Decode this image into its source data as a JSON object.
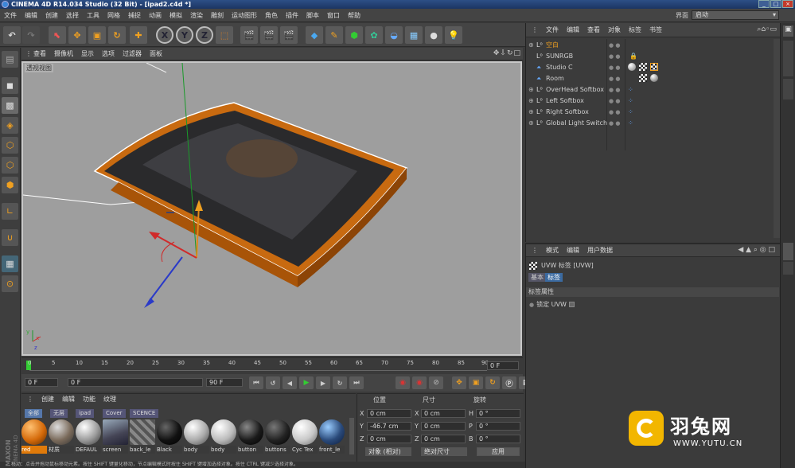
{
  "window": {
    "title": "CINEMA 4D R14.034 Studio (32 Bit) - [ipad2.c4d *]"
  },
  "menu": [
    "文件",
    "编辑",
    "创建",
    "选择",
    "工具",
    "网格",
    "捕捉",
    "动画",
    "模拟",
    "渲染",
    "雕刻",
    "运动图形",
    "角色",
    "插件",
    "脚本",
    "窗口",
    "帮助"
  ],
  "layout": {
    "label": "界面",
    "value": "启动"
  },
  "toolbar": {
    "x": "X",
    "y": "Y",
    "z": "Z"
  },
  "viewport": {
    "menu": [
      "查看",
      "摄像机",
      "显示",
      "选项",
      "过滤器",
      "面板"
    ],
    "label": "透视视图"
  },
  "timeline": {
    "ticks": [
      "0",
      "5",
      "10",
      "15",
      "20",
      "25",
      "30",
      "35",
      "40",
      "45",
      "50",
      "55",
      "60",
      "65",
      "70",
      "75",
      "80",
      "85",
      "90"
    ],
    "end_field": "0 F"
  },
  "transport": {
    "start": "0 F",
    "cur": "0 F",
    "mid": "90 F",
    "end": "90 F"
  },
  "materials": {
    "menu": [
      "创建",
      "编辑",
      "功能",
      "纹理"
    ],
    "tabs": [
      "全部",
      "无层",
      "ipad",
      "Cover",
      "SCENCE"
    ],
    "items": [
      {
        "name": "red",
        "color": "#d46a0a"
      },
      {
        "name": "材质",
        "color": "#7a6a5a"
      },
      {
        "name": "DEFAUL",
        "color": "#9a9a9a"
      },
      {
        "name": "screen",
        "color": "#6a7080"
      },
      {
        "name": "back_le",
        "color": "#777"
      },
      {
        "name": "Black",
        "color": "#111"
      },
      {
        "name": "body",
        "color": "#aaa"
      },
      {
        "name": "body",
        "color": "#bbb"
      },
      {
        "name": "button",
        "color": "#1a1a1a"
      },
      {
        "name": "buttons",
        "color": "#222"
      },
      {
        "name": "Cyc Tex",
        "color": "#c8c8c8"
      },
      {
        "name": "front_le",
        "color": "#2a4a7a"
      }
    ]
  },
  "coords": {
    "headers": [
      "位置",
      "尺寸",
      "旋转"
    ],
    "rows": [
      {
        "a": "X",
        "av": "0 cm",
        "b": "X",
        "bv": "0 cm",
        "c": "H",
        "cv": "0 °"
      },
      {
        "a": "Y",
        "av": "-46.7 cm",
        "b": "Y",
        "bv": "0 cm",
        "c": "P",
        "cv": "0 °"
      },
      {
        "a": "Z",
        "av": "0 cm",
        "b": "Z",
        "bv": "0 cm",
        "c": "B",
        "cv": "0 °"
      }
    ],
    "mode1": "对象 (相对)",
    "mode2": "绝对尺寸",
    "apply": "应用"
  },
  "objects": {
    "menu": [
      "文件",
      "编辑",
      "查看",
      "对象",
      "标签",
      "书签"
    ],
    "items": [
      {
        "label": "空白",
        "hl": true
      },
      {
        "label": "SUNRGB",
        "hl": false
      },
      {
        "label": "Studio C",
        "hl": false
      },
      {
        "label": "Room",
        "hl": false
      },
      {
        "label": "OverHead Softbox",
        "hl": false
      },
      {
        "label": "Left Softbox",
        "hl": false
      },
      {
        "label": "Right Softbox",
        "hl": false
      },
      {
        "label": "Global Light Switch",
        "hl": false
      }
    ]
  },
  "attributes": {
    "menu": [
      "模式",
      "编辑",
      "用户数据"
    ],
    "title": "UVW 标签 [UVW]",
    "tabs": [
      "基本",
      "标签"
    ],
    "section": "标签属性",
    "field": "锁定 UVW"
  },
  "status": {
    "text": "移动：点击并拖动鼠标移动元素。按住 SHIFT 键量化移动，节点编辑模式时按住 SHIFT 键增加选择对象。按住 CTRL 键减少选择对象。"
  },
  "watermark": {
    "brand": "羽兔网",
    "url": "WWW.YUTU.CN",
    "logo": "MAXON CINEMA 4D"
  }
}
